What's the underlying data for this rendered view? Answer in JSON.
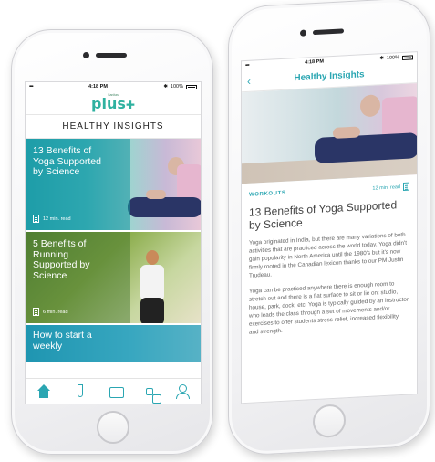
{
  "status": {
    "signal": "•••• ",
    "time": "4:18 PM",
    "bluetooth": "✱",
    "battery": "100%"
  },
  "left": {
    "logo": {
      "small": "Sanitas",
      "main": "plus"
    },
    "section_title": "HEALTHY INSIGHTS",
    "cards": [
      {
        "title": "13 Benefits of Yoga Supported by Science",
        "read": "12 min. read"
      },
      {
        "title": "5 Benefits of Running Supported by Science",
        "read": "6 min. read"
      },
      {
        "title": "How to start a weekly",
        "read": ""
      }
    ],
    "nav": [
      "home-icon",
      "test-tube-icon",
      "folder-icon",
      "swap-icon",
      "user-icon"
    ]
  },
  "right": {
    "header_title": "Healthy Insights",
    "back": "‹",
    "category": "WORKOUTS",
    "read_time": "12 min. read",
    "title": "13 Benefits of Yoga Supported by Science",
    "p1": "Yoga originated in India, but there are many variations of both activities that are practiced across the world today. Yoga didn't gain popularity in North America until the 1980's but it's now firmly rooted in the Canadian lexicon thanks to our PM Justin Trudeau.",
    "p2": "Yoga can be practiced anywhere there is enough room to stretch out and there is a flat surface to sit or lie on: studio, house, park, dock, etc. Yoga is typically guided by an instructor who leads the class through a set of movements and/or exercises to offer students stress-relief, increased flexibility and strength."
  },
  "colors": {
    "accent": "#2aa6b2"
  }
}
